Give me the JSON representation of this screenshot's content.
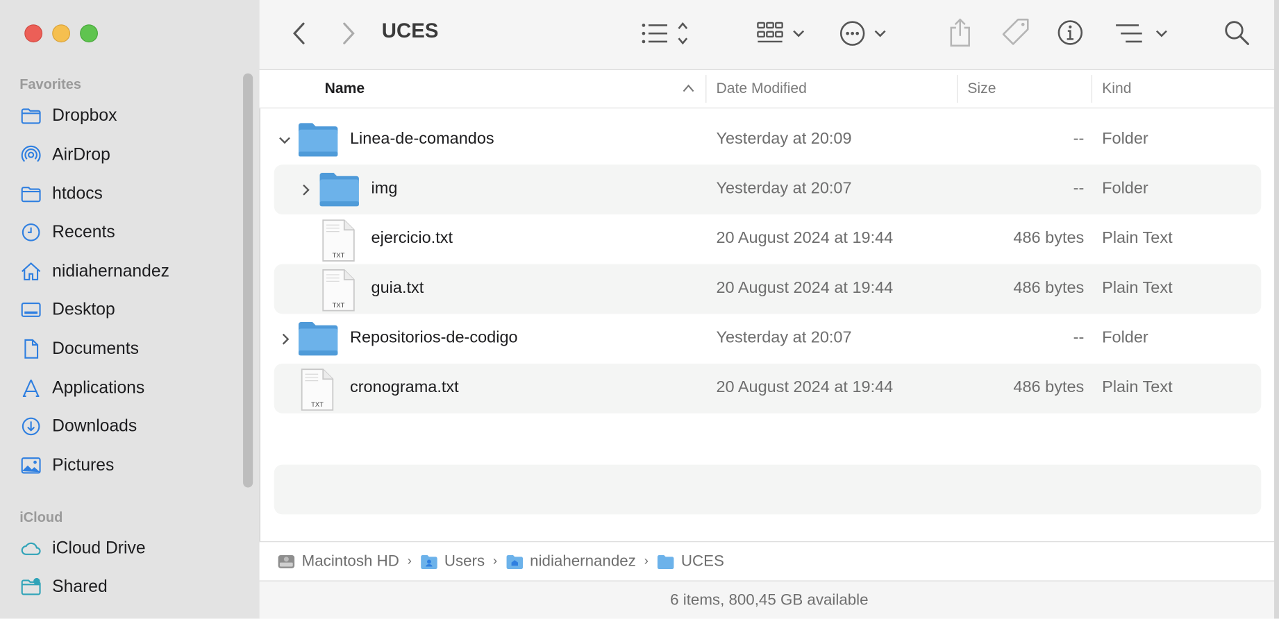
{
  "window": {
    "title": "UCES"
  },
  "colors": {
    "accent": "#2f7fe0",
    "folder": "#6cb2ea",
    "sidebar_bg": "#e3e3e3"
  },
  "sidebar": {
    "favorites_label": "Favorites",
    "favorites": [
      {
        "label": "Dropbox",
        "icon": "folder-icon"
      },
      {
        "label": "AirDrop",
        "icon": "airdrop-icon"
      },
      {
        "label": "htdocs",
        "icon": "folder-icon"
      },
      {
        "label": "Recents",
        "icon": "clock-icon"
      },
      {
        "label": "nidiahernandez",
        "icon": "home-icon"
      },
      {
        "label": "Desktop",
        "icon": "desktop-icon"
      },
      {
        "label": "Documents",
        "icon": "document-icon"
      },
      {
        "label": "Applications",
        "icon": "applications-icon"
      },
      {
        "label": "Downloads",
        "icon": "download-icon"
      },
      {
        "label": "Pictures",
        "icon": "photo-icon"
      }
    ],
    "icloud_label": "iCloud",
    "icloud": [
      {
        "label": "iCloud Drive",
        "icon": "cloud-icon"
      },
      {
        "label": "Shared",
        "icon": "shared-folder-icon"
      }
    ]
  },
  "columns": {
    "name": "Name",
    "date": "Date Modified",
    "size": "Size",
    "kind": "Kind"
  },
  "rows": [
    {
      "name": "Linea-de-comandos",
      "date": "Yesterday at 20:09",
      "size": "--",
      "kind": "Folder",
      "type": "folder",
      "disclosure": "expanded"
    },
    {
      "name": "img",
      "date": "Yesterday at 20:07",
      "size": "--",
      "kind": "Folder",
      "type": "folder",
      "disclosure": "collapsed"
    },
    {
      "name": "ejercicio.txt",
      "date": "20 August 2024 at 19:44",
      "size": "486 bytes",
      "kind": "Plain Text",
      "type": "txt",
      "icon_label": "TXT"
    },
    {
      "name": "guia.txt",
      "date": "20 August 2024 at 19:44",
      "size": "486 bytes",
      "kind": "Plain Text",
      "type": "txt",
      "icon_label": "TXT"
    },
    {
      "name": "Repositorios-de-codigo",
      "date": "Yesterday at 20:07",
      "size": "--",
      "kind": "Folder",
      "type": "folder",
      "disclosure": "collapsed"
    },
    {
      "name": "cronograma.txt",
      "date": "20 August 2024 at 19:44",
      "size": "486 bytes",
      "kind": "Plain Text",
      "type": "txt",
      "icon_label": "TXT"
    }
  ],
  "pathbar": [
    "Macintosh HD",
    "Users",
    "nidiahernandez",
    "UCES"
  ],
  "status": "6 items, 800,45 GB available"
}
